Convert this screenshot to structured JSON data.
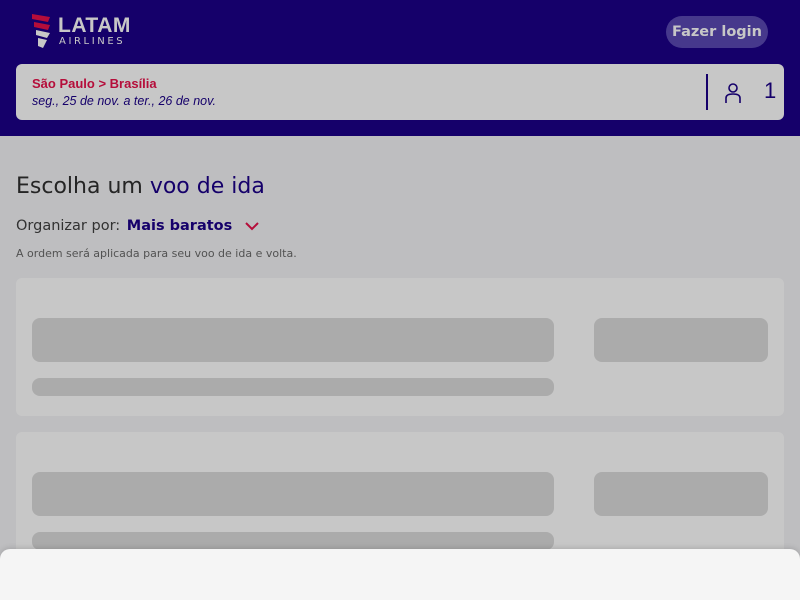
{
  "app": {
    "brand": "LATAM",
    "brand_sub": "AIRLINES",
    "login_label": "Fazer login"
  },
  "search": {
    "route": "São Paulo > Brasília",
    "dates": "seg., 25 de nov. a ter., 26 de nov.",
    "passenger_count": "1"
  },
  "main": {
    "title_prefix": "Escolha um",
    "title_accent": "voo de ida",
    "sort_label": "Organizar por:",
    "sort_value": "Mais baratos",
    "sort_note": "A ordem será aplicada para seu voo de ida e volta."
  },
  "icons": {
    "logo": "latam-logo-icon",
    "passenger": "person-icon",
    "sort": "chevron-down-icon"
  },
  "colors": {
    "header_bg": "#1b0088",
    "accent_red": "#e8114b",
    "login_bg": "#5a48b4",
    "skeleton": "#dcdcdc"
  }
}
